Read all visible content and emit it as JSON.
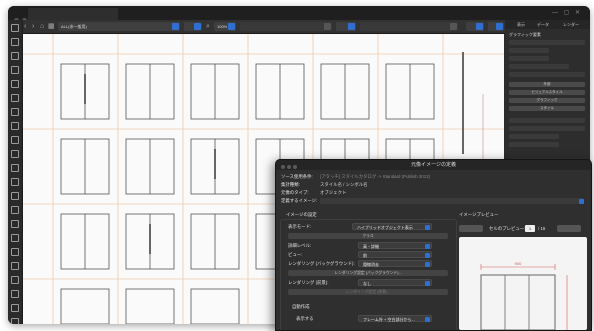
{
  "toolbar": {
    "layer_dropdown": "ALL(非一般用)",
    "zoom_dropdown": "100%",
    "field_a": "",
    "field_b": ""
  },
  "right_panel": {
    "tabs": [
      "表示",
      "データ",
      "レンダー"
    ],
    "section_title": "グラフィック要素",
    "buttons": [
      "外部",
      "ビジュアルスタイル",
      "グラフィック",
      "スタイル"
    ]
  },
  "dialog": {
    "title": "元像イメージの定義",
    "source_label": "ソース使用条件:",
    "source_value": "[アタッチ] スタイルカタログ -> Standard (Publish 2013)",
    "kind_label": "集計種類:",
    "kind_value": "スタイル名 / シンボル名",
    "type_label": "元像のタイプ:",
    "type_value": "オブジェクト",
    "define_label": "定義するイメージ:",
    "settings_heading": "イメージの設定",
    "preview_heading": "イメージプレビュー",
    "display_mode_label": "表示モード:",
    "display_mode_value": "ハイブリッドオブジェクト表示",
    "class_bar": "クラス",
    "detail_level_label": "詳細レベル:",
    "detail_level_value": "高・詳細",
    "view_label": "ビュー:",
    "view_value": "前",
    "rendering_bg_label": "レンダリング (バックグラウンド):",
    "rendering_bg_value": "隠線消去",
    "rendering_bg_bar": "レンダリング設定 (バックグラウンド)...",
    "rendering_fg_label": "レンダリング (前景):",
    "rendering_fg_value": "なし",
    "rendering_fg_bar": "レンダリング設定 (前景)...",
    "auto_label": "自動作成",
    "frame_label": "表示する",
    "frame_value": "フレーム外 + 空白部分から...",
    "preview_cell_label": "セルのプレビュー:",
    "preview_cell_value": "1",
    "preview_cell_total": "/ 16",
    "preview_dimension": "900"
  }
}
